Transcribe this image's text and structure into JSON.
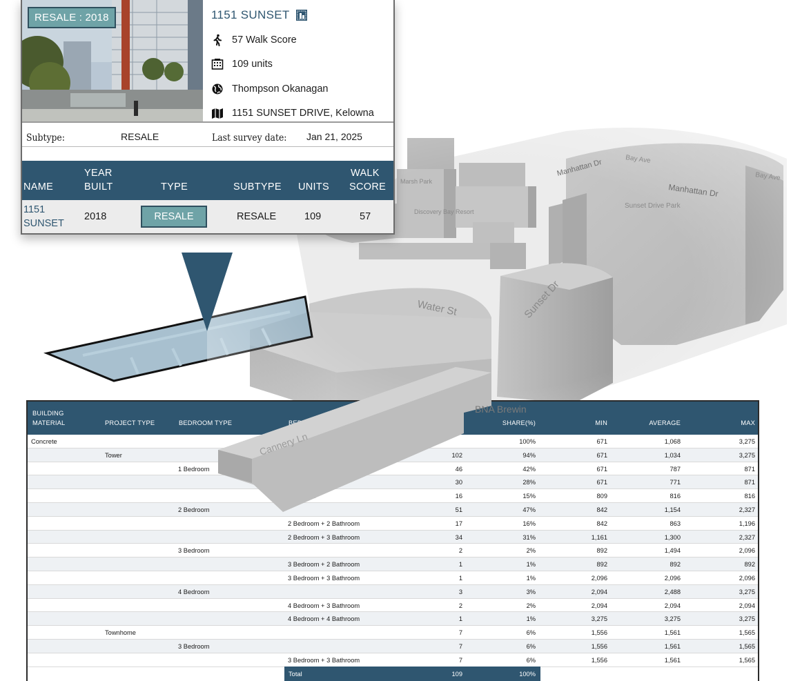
{
  "map": {
    "street_labels": [
      "Bay Ave",
      "Manhattan Dr",
      "Manhattan Dr",
      "Bay Ave",
      "Sunset Drive Park",
      "Marsh Park",
      "Discovery Bay Resort",
      "Water St",
      "Sunset Dr",
      "BNA Brewin",
      "Cannery Ln"
    ],
    "building_color": "#b9b9b9",
    "highlight_color": "#8faec2"
  },
  "card": {
    "badge": "RESALE : 2018",
    "name": "1151 SUNSET",
    "walk_score": "57 Walk Score",
    "units": "109 units",
    "region": "Thompson Okanagan",
    "address": "1151 SUNSET DRIVE, Kelowna",
    "subtype_label": "Subtype:",
    "subtype_value": "RESALE",
    "survey_label": "Last survey date:",
    "survey_value": "Jan 21, 2025",
    "icons": [
      "building-list-icon",
      "walk-icon",
      "apartment-icon",
      "globe-icon",
      "map-icon"
    ],
    "accent": "#2f5670",
    "badge_color": "#6fa3a7"
  },
  "mini_table": {
    "headers": {
      "name": "NAME",
      "year_1": "YEAR",
      "year_2": "BUILT",
      "type": "TYPE",
      "subtype": "SUBTYPE",
      "units": "UNITS",
      "walk_1": "WALK",
      "walk_2": "SCORE"
    },
    "row": {
      "name_1": "1151",
      "name_2": "SUNSET",
      "year": "2018",
      "type": "RESALE",
      "subtype": "RESALE",
      "units": "109",
      "walk": "57"
    }
  },
  "table": {
    "headers": {
      "material_1": "BUILDING",
      "material_2": "MATERIAL",
      "project": "PROJECT TYPE",
      "bedroom": "BEDROOM TYPE",
      "bedbath": "BEDR",
      "share": "SHARE(%)",
      "min": "MIN",
      "avg": "AVERAGE",
      "max": "MAX"
    },
    "rows": [
      {
        "c1": "Concrete",
        "c2": "",
        "c3": "",
        "c4": "",
        "units": "",
        "share": "100%",
        "min": "671",
        "avg": "1,068",
        "max": "3,275"
      },
      {
        "c1": "",
        "c2": "Tower",
        "c3": "",
        "c4": "",
        "units": "102",
        "share": "94%",
        "min": "671",
        "avg": "1,034",
        "max": "3,275"
      },
      {
        "c1": "",
        "c2": "",
        "c3": "1 Bedroom",
        "c4": "",
        "units": "46",
        "share": "42%",
        "min": "671",
        "avg": "787",
        "max": "871"
      },
      {
        "c1": "",
        "c2": "",
        "c3": "",
        "c4": "",
        "units": "30",
        "share": "28%",
        "min": "671",
        "avg": "771",
        "max": "871"
      },
      {
        "c1": "",
        "c2": "",
        "c3": "",
        "c4": "Bathroom",
        "units": "16",
        "share": "15%",
        "min": "809",
        "avg": "816",
        "max": "816"
      },
      {
        "c1": "",
        "c2": "",
        "c3": "2 Bedroom",
        "c4": "",
        "units": "51",
        "share": "47%",
        "min": "842",
        "avg": "1,154",
        "max": "2,327"
      },
      {
        "c1": "",
        "c2": "",
        "c3": "",
        "c4": "2 Bedroom + 2 Bathroom",
        "units": "17",
        "share": "16%",
        "min": "842",
        "avg": "863",
        "max": "1,196"
      },
      {
        "c1": "",
        "c2": "",
        "c3": "",
        "c4": "2 Bedroom + 3 Bathroom",
        "units": "34",
        "share": "31%",
        "min": "1,161",
        "avg": "1,300",
        "max": "2,327"
      },
      {
        "c1": "",
        "c2": "",
        "c3": "3 Bedroom",
        "c4": "",
        "units": "2",
        "share": "2%",
        "min": "892",
        "avg": "1,494",
        "max": "2,096"
      },
      {
        "c1": "",
        "c2": "",
        "c3": "",
        "c4": "3 Bedroom + 2 Bathroom",
        "units": "1",
        "share": "1%",
        "min": "892",
        "avg": "892",
        "max": "892"
      },
      {
        "c1": "",
        "c2": "",
        "c3": "",
        "c4": "3 Bedroom + 3 Bathroom",
        "units": "1",
        "share": "1%",
        "min": "2,096",
        "avg": "2,096",
        "max": "2,096"
      },
      {
        "c1": "",
        "c2": "",
        "c3": "4 Bedroom",
        "c4": "",
        "units": "3",
        "share": "3%",
        "min": "2,094",
        "avg": "2,488",
        "max": "3,275"
      },
      {
        "c1": "",
        "c2": "",
        "c3": "",
        "c4": "4 Bedroom + 3 Bathroom",
        "units": "2",
        "share": "2%",
        "min": "2,094",
        "avg": "2,094",
        "max": "2,094"
      },
      {
        "c1": "",
        "c2": "",
        "c3": "",
        "c4": "4 Bedroom + 4 Bathroom",
        "units": "1",
        "share": "1%",
        "min": "3,275",
        "avg": "3,275",
        "max": "3,275"
      },
      {
        "c1": "",
        "c2": "Townhome",
        "c3": "",
        "c4": "",
        "units": "7",
        "share": "6%",
        "min": "1,556",
        "avg": "1,561",
        "max": "1,565"
      },
      {
        "c1": "",
        "c2": "",
        "c3": "3 Bedroom",
        "c4": "",
        "units": "7",
        "share": "6%",
        "min": "1,556",
        "avg": "1,561",
        "max": "1,565"
      },
      {
        "c1": "",
        "c2": "",
        "c3": "",
        "c4": "3 Bedroom + 3 Bathroom",
        "units": "7",
        "share": "6%",
        "min": "1,556",
        "avg": "1,561",
        "max": "1,565"
      }
    ],
    "footer": {
      "label": "Total",
      "units": "109",
      "share": "100%"
    },
    "header_color": "#2f5670",
    "alt_row_color": "#eef1f4"
  }
}
